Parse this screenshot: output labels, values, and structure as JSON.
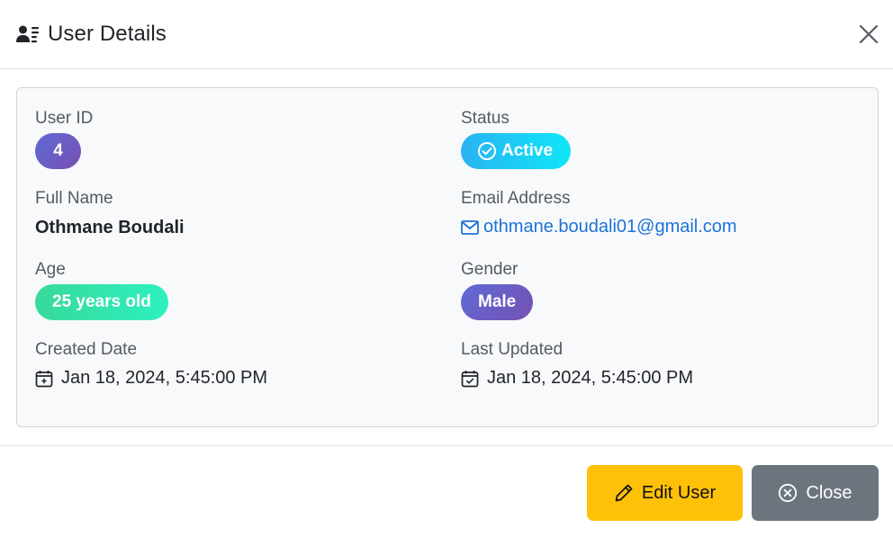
{
  "header": {
    "title": "User Details",
    "icon": "user-lines-icon",
    "close_icon": "close-icon"
  },
  "details": {
    "user_id": {
      "label": "User ID",
      "value": "4"
    },
    "status": {
      "label": "Status",
      "value": "Active",
      "icon": "check-circle-icon"
    },
    "full_name": {
      "label": "Full Name",
      "value": "Othmane Boudali"
    },
    "email": {
      "label": "Email Address",
      "value": "othmane.boudali01@gmail.com",
      "icon": "envelope-icon"
    },
    "age": {
      "label": "Age",
      "value": "25 years old"
    },
    "gender": {
      "label": "Gender",
      "value": "Male"
    },
    "created": {
      "label": "Created Date",
      "value": "Jan 18, 2024, 5:45:00 PM",
      "icon": "calendar-plus-icon"
    },
    "updated": {
      "label": "Last Updated",
      "value": "Jan 18, 2024, 5:45:00 PM",
      "icon": "calendar-check-icon"
    }
  },
  "footer": {
    "edit_label": "Edit User",
    "edit_icon": "pencil-icon",
    "close_label": "Close",
    "close_icon": "x-circle-icon"
  },
  "colors": {
    "edit_button": "#ffc107",
    "close_button": "#6c757d",
    "link": "#1e73d8",
    "card_background": "#f8f9fa"
  }
}
